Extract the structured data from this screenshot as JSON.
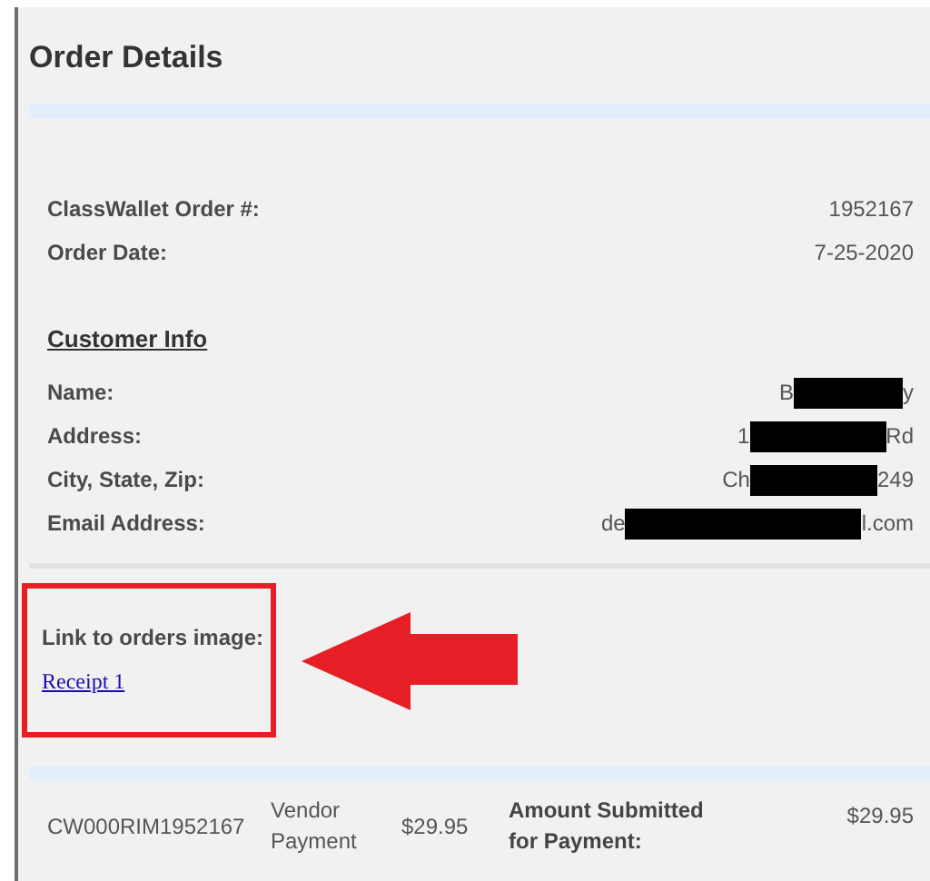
{
  "title": "Order Details",
  "order": [
    {
      "label": "ClassWallet Order #:",
      "value": "1952167"
    },
    {
      "label": "Order Date:",
      "value": "7-25-2020"
    }
  ],
  "customer_info": {
    "heading": "Customer Info",
    "fields": [
      {
        "label": "Name:",
        "value_start": "B",
        "value_end": "y",
        "redacted": true
      },
      {
        "label": "Address:",
        "value_start": "1",
        "value_end": "Rd",
        "redacted": true
      },
      {
        "label": "City, State, Zip:",
        "value_start": "Ch",
        "value_end": "249",
        "redacted": true
      },
      {
        "label": "Email Address:",
        "value_start": "de",
        "value_end": "l.com",
        "redacted": true
      }
    ]
  },
  "receipt_links": {
    "label": "Link to orders image:",
    "links": [
      "Receipt 1"
    ]
  },
  "payment": {
    "order_id": "CW000RIM1952167",
    "type": "Vendor Payment",
    "amount": "$29.95",
    "summary": [
      {
        "label": "Amount Submitted for Payment:",
        "value": "$29.95"
      }
    ]
  }
}
